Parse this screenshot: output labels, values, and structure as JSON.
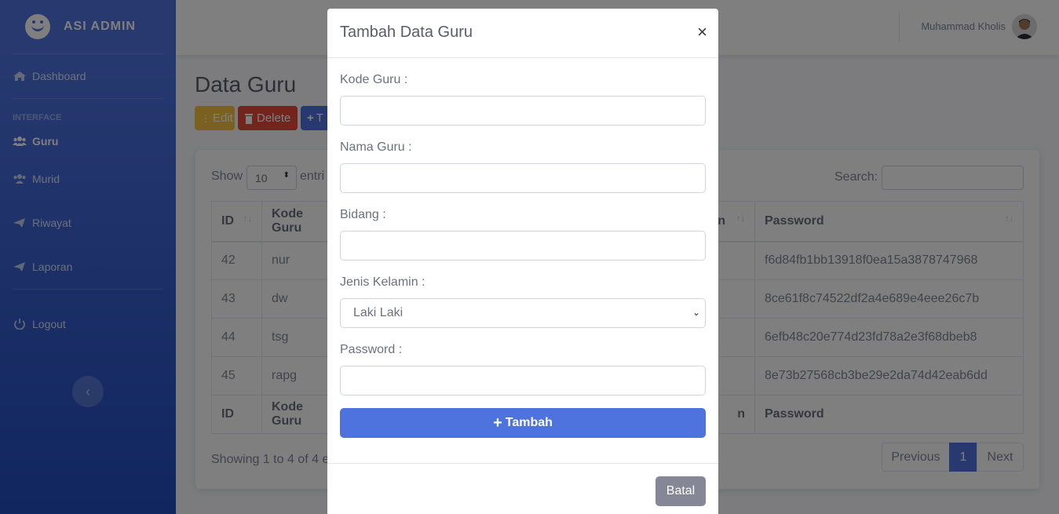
{
  "sidebar": {
    "brand": "ASI ADMIN",
    "heading": "INTERFACE",
    "items": [
      {
        "label": "Dashboard"
      },
      {
        "label": "Guru"
      },
      {
        "label": "Murid"
      },
      {
        "label": "Riwayat"
      },
      {
        "label": "Laporan"
      },
      {
        "label": "Logout"
      }
    ],
    "toggle_icon": "chevron-left-icon"
  },
  "topbar": {
    "user_name": "Muhammad Kholis"
  },
  "page": {
    "title": "Data Guru",
    "buttons": {
      "edit": "Edit",
      "delete": "Delete",
      "add": "T"
    },
    "show_label": "Show",
    "show_value": "10",
    "entries_label": "entri",
    "search_label": "Search:",
    "table": {
      "headers": [
        "ID",
        "Kode Guru",
        "n",
        "Password"
      ],
      "rows": [
        {
          "id": "42",
          "kode": "nur",
          "password": "f6d84fb1bb13918f0ea15a3878747968"
        },
        {
          "id": "43",
          "kode": "dw",
          "password": "8ce61f8c74522df2a4e689e4eee26c7b"
        },
        {
          "id": "44",
          "kode": "tsg",
          "password": "6efb48c20e774d23fd78a2e3f68dbeb8"
        },
        {
          "id": "45",
          "kode": "rapg",
          "password": "8e73b27568cb3be29e2da74d42eab6dd"
        }
      ],
      "footer": [
        "ID",
        "Kode Guru",
        "n",
        "Password"
      ]
    },
    "info": "Showing 1 to 4 of 4 e",
    "pagination": {
      "prev": "Previous",
      "current": "1",
      "next": "Next"
    }
  },
  "modal": {
    "title": "Tambah Data Guru",
    "close": "×",
    "fields": {
      "kode": "Kode Guru :",
      "nama": "Nama Guru :",
      "bidang": "Bidang :",
      "jenis": "Jenis Kelamin :",
      "jenis_value": "Laki Laki",
      "password": "Password :"
    },
    "submit": "Tambah",
    "cancel": "Batal"
  },
  "colors": {
    "primary": "#4e73df",
    "warning": "#f6c23e",
    "danger": "#e74a3b",
    "secondary": "#858796"
  }
}
